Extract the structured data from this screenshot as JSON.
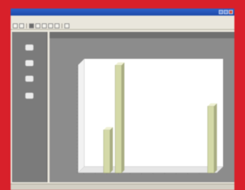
{
  "window": {
    "title": ""
  },
  "menu": [],
  "toolbar": {
    "buttons": 12
  },
  "sidebar": {
    "items": [
      {
        "icon": "box-icon",
        "label": ""
      },
      {
        "icon": "monitor-icon",
        "label": ""
      },
      {
        "icon": "display-icon",
        "label": ""
      },
      {
        "icon": "gear-icon",
        "label": ""
      }
    ]
  },
  "chart_window": {
    "title": ""
  },
  "status": {
    "text": ""
  },
  "colors": {
    "frame": "#d8202a",
    "bar": "#d4d9a8",
    "plot": "#ffffff",
    "panel": "#7b7b7b"
  },
  "chart_data": {
    "type": "bar",
    "title": "",
    "xlabel": "",
    "ylabel": "",
    "categories": [
      "",
      "",
      "",
      "",
      "",
      "",
      "",
      "",
      "",
      "",
      "",
      ""
    ],
    "values": [
      0,
      0,
      40,
      100,
      0,
      0,
      0,
      0,
      0,
      0,
      0,
      62
    ],
    "ylim": [
      0,
      100
    ],
    "grid": false,
    "legend": "none"
  }
}
